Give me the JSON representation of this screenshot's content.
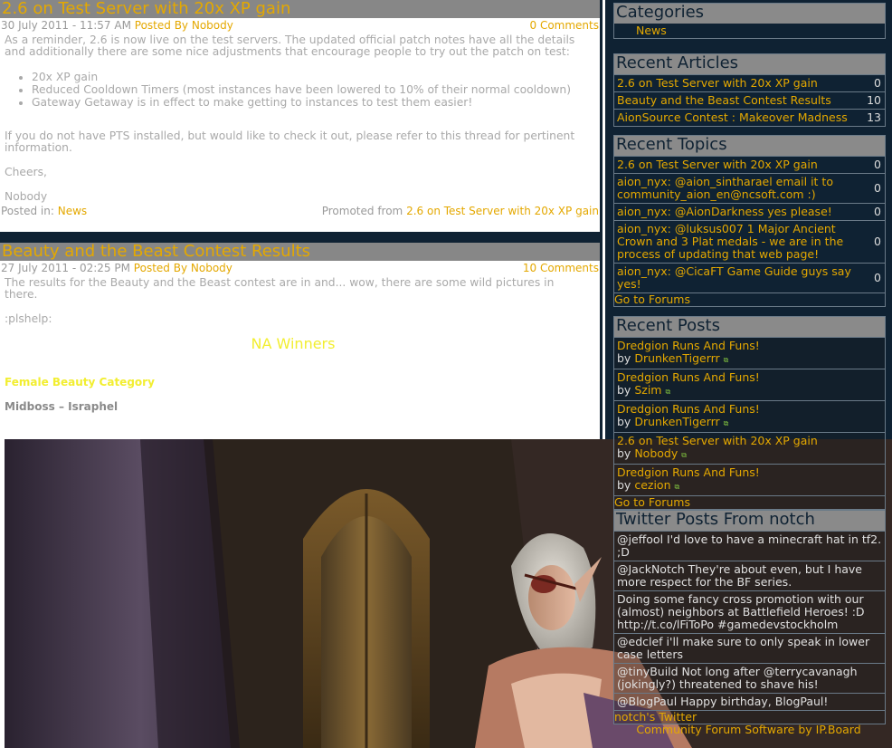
{
  "articles": [
    {
      "title": "2.6 on Test Server with 20x XP gain",
      "date": "30 July 2011 - 11:57 AM",
      "posted_by_label": "Posted By",
      "author": "Nobody",
      "comments": "0 Comments",
      "intro": "As a reminder, 2.6 is now live on the test servers. The updated official patch notes have all the details and additionally there are some nice adjustments that encourage people to try out the patch on test:",
      "bullets": [
        "20x XP gain",
        "Reduced Cooldown Timers (most instances have been lowered to 10% of their normal cooldown)",
        "Gateway Getaway is in effect to make getting to instances to test them easier!"
      ],
      "pts_note": "If you do not have PTS installed, but would like to check it out, please refer to this thread for pertinent information.",
      "signoff": "Cheers,",
      "signature": "Nobody",
      "posted_in_label": "Posted in:",
      "category": "News",
      "promoted_label": "Promoted from",
      "promoted_link": "2.6 on Test Server with 20x XP gain"
    },
    {
      "title": "Beauty and the Beast Contest Results",
      "date": "27 July 2011 - 02:25 PM",
      "posted_by_label": "Posted By",
      "author": "Nobody",
      "comments": "10 Comments",
      "intro": "The results for the Beauty and the Beast contest are in and... wow, there are some wild pictures in there.",
      "emote": ":plshelp:",
      "na_winners": "NA Winners",
      "female_category": "Female Beauty Category",
      "winner_line": "Midboss – Israphel"
    }
  ],
  "sidebar": {
    "categories": {
      "title": "Categories",
      "items": [
        "News"
      ]
    },
    "recent_articles": {
      "title": "Recent Articles",
      "items": [
        {
          "label": "2.6 on Test Server with 20x XP gain",
          "count": "0"
        },
        {
          "label": "Beauty and the Beast Contest Results",
          "count": "10"
        },
        {
          "label": "AionSource Contest : Makeover Madness",
          "count": "13"
        }
      ]
    },
    "recent_topics": {
      "title": "Recent Topics",
      "items": [
        {
          "label": "2.6 on Test Server with 20x XP gain",
          "count": "0"
        },
        {
          "label": "aion_nyx: @aion_sintharael email it to community_aion_en@ncsoft.com :)",
          "count": "0"
        },
        {
          "label": "aion_nyx: @AionDarkness yes please!",
          "count": "0"
        },
        {
          "label": "aion_nyx: @luksus007 1 Major Ancient Crown and 3 Plat medals - we are in the process of updating that web page!",
          "count": "0"
        },
        {
          "label": "aion_nyx: @CicaFT Game Guide guys say yes!",
          "count": "0"
        }
      ],
      "footer": "Go to Forums"
    },
    "recent_posts": {
      "title": "Recent Posts",
      "by_label": "by",
      "items": [
        {
          "topic": "Dredgion Runs And Funs!",
          "user": "DrunkenTigerrr"
        },
        {
          "topic": "Dredgion Runs And Funs!",
          "user": "Szim"
        },
        {
          "topic": "Dredgion Runs And Funs!",
          "user": "DrunkenTigerrr"
        },
        {
          "topic": "2.6 on Test Server with 20x XP gain",
          "user": "Nobody"
        },
        {
          "topic": "Dredgion Runs And Funs!",
          "user": "cezion"
        }
      ],
      "footer": "Go to Forums"
    },
    "twitter": {
      "title": "Twitter Posts From notch",
      "tweets": [
        "@jeffool I'd love to have a minecraft hat in tf2. ;D",
        "@JackNotch They're about even, but I have more respect for the BF series.",
        "Doing some fancy cross promotion with our (almost) neighbors at Battlefield Heroes! :D http://t.co/lFiToPo #gamedevstockholm",
        "@edclef i'll make sure to only speak in lower case letters",
        "@tinyBuild Not long after @terrycavanagh (jokingly?) threatened to shave his!",
        "@BlogPaul Happy birthday, BlogPaul!"
      ],
      "footer": "notch's Twitter"
    },
    "credit": "Community Forum Software by IP.Board"
  }
}
